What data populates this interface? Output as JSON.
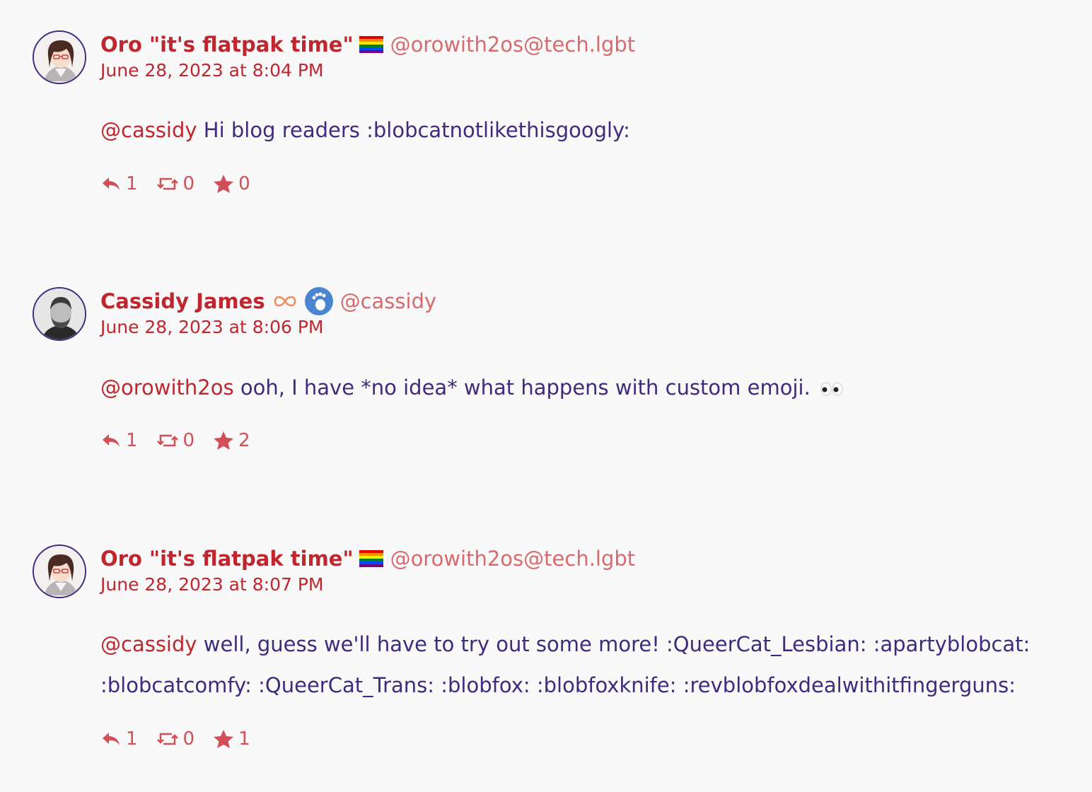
{
  "posts": [
    {
      "display_name": "Oro \"it's flatpak time\"",
      "handle": "@orowith2os@tech.lgbt",
      "timestamp": "June 28, 2023 at 8:04 PM",
      "mention": "@cassidy",
      "text": " Hi blog readers :blobcatnotlikethisgoogly:",
      "replies": "1",
      "boosts": "0",
      "favorites": "0"
    },
    {
      "display_name": "Cassidy James",
      "handle": "@cassidy",
      "timestamp": "June 28, 2023 at 8:06 PM",
      "mention": "@orowith2os",
      "text": " ooh, I have *no idea* what happens with custom emoji.",
      "replies": "1",
      "boosts": "0",
      "favorites": "2"
    },
    {
      "display_name": "Oro \"it's flatpak time\"",
      "handle": "@orowith2os@tech.lgbt",
      "timestamp": "June 28, 2023 at 8:07 PM",
      "mention": "@cassidy",
      "text": " well, guess we'll have to try out some more! :QueerCat_Lesbian: :apartyblobcat: :blobcatcomfy: :QueerCat_Trans: :blobfox: :blobfoxknife: :revblobfoxdealwithitfingerguns:",
      "replies": "1",
      "boosts": "0",
      "favorites": "1"
    }
  ],
  "colors": {
    "accent": "#c0262d",
    "handle": "#d86a6d",
    "body_text": "#3f2a7e",
    "background": "#f9f9fa"
  },
  "icons": [
    "reply-icon",
    "boost-icon",
    "star-icon",
    "rainbow-flag-icon",
    "infinity-icon",
    "gnome-foot-icon",
    "eyes-emoji-icon"
  ]
}
